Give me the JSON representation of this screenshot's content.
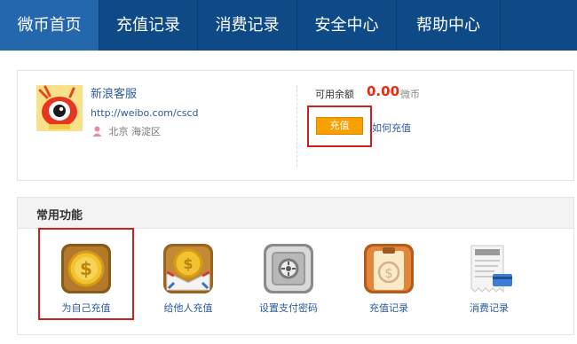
{
  "nav": {
    "tabs": [
      {
        "label": "微币首页",
        "active": true
      },
      {
        "label": "充值记录",
        "active": false
      },
      {
        "label": "消费记录",
        "active": false
      },
      {
        "label": "安全中心",
        "active": false
      },
      {
        "label": "帮助中心",
        "active": false
      }
    ]
  },
  "profile": {
    "name": "新浪客服",
    "url": "http://weibo.com/cscd",
    "location": "北京 海淀区",
    "avatar_icon": "sina-eye-avatar"
  },
  "balance": {
    "label": "可用余额",
    "amount": "0.00",
    "unit": "微币",
    "recharge_label": "充值",
    "howto_label": "如何充值"
  },
  "functions": {
    "title": "常用功能",
    "items": [
      {
        "label": "为自己充值",
        "icon": "gold-coin-icon"
      },
      {
        "label": "给他人充值",
        "icon": "coin-envelope-icon"
      },
      {
        "label": "设置支付密码",
        "icon": "safe-icon"
      },
      {
        "label": "充值记录",
        "icon": "clipboard-icon"
      },
      {
        "label": "消费记录",
        "icon": "receipt-icon"
      }
    ]
  },
  "colors": {
    "nav_bg": "#0d4a86",
    "nav_active": "#2567ad",
    "accent_orange": "#f7a000",
    "amount_red": "#e52b0c",
    "highlight_red": "#cf1f1f",
    "link_blue": "#2b5aa0"
  }
}
